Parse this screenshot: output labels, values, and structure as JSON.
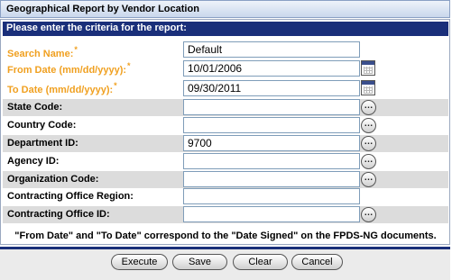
{
  "window": {
    "title": "Geographical Report by Vendor Location"
  },
  "form": {
    "header": "Please enter the criteria for the report:",
    "fields": [
      {
        "label": "Search Name:",
        "required": true,
        "value": "Default"
      },
      {
        "label": "From Date (mm/dd/yyyy):",
        "required": true,
        "value": "10/01/2006"
      },
      {
        "label": "To Date (mm/dd/yyyy):",
        "required": true,
        "value": "09/30/2011"
      },
      {
        "label": "State Code:",
        "required": false,
        "value": ""
      },
      {
        "label": "Country Code:",
        "required": false,
        "value": ""
      },
      {
        "label": "Department ID:",
        "required": false,
        "value": "9700"
      },
      {
        "label": "Agency ID:",
        "required": false,
        "value": ""
      },
      {
        "label": "Organization Code:",
        "required": false,
        "value": ""
      },
      {
        "label": "Contracting Office Region:",
        "required": false,
        "value": ""
      },
      {
        "label": "Contracting Office ID:",
        "required": false,
        "value": ""
      }
    ],
    "lookup_glyph": "…",
    "required_marker": "*",
    "note": "\"From Date\" and \"To Date\" correspond to the \"Date Signed\" on the FPDS-NG documents."
  },
  "buttons": {
    "execute": "Execute",
    "save": "Save",
    "clear": "Clear",
    "cancel": "Cancel"
  },
  "colors": {
    "header_bg": "#1a2f7a",
    "required_label": "#f0a020",
    "row_shade": "#dcdcdc"
  }
}
